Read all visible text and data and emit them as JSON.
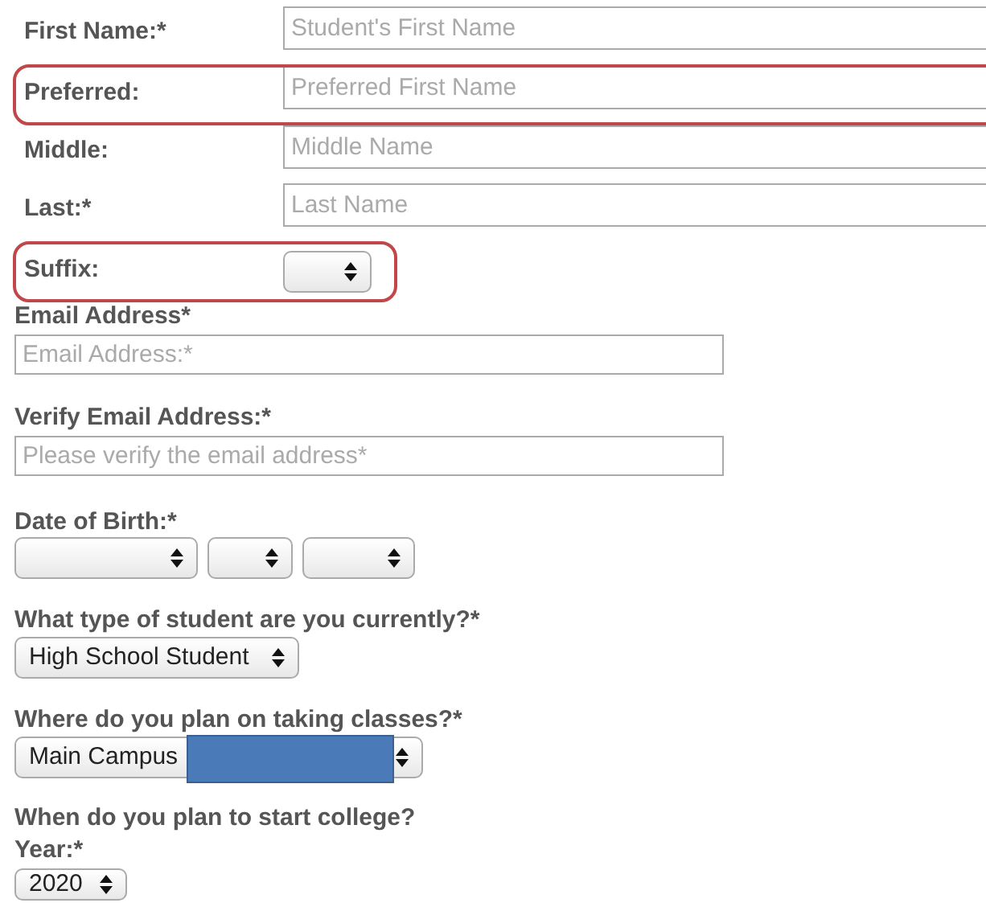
{
  "name_rows": [
    {
      "kind": "text",
      "label": "First Name:*",
      "placeholder": "Student's First Name",
      "highlighted": false
    },
    {
      "kind": "text",
      "label": "Preferred:",
      "placeholder": "Preferred First Name",
      "highlighted": true
    },
    {
      "kind": "text",
      "label": "Middle:",
      "placeholder": "Middle Name",
      "highlighted": false
    },
    {
      "kind": "text",
      "label": "Last:*",
      "placeholder": "Last Name",
      "highlighted": false
    },
    {
      "kind": "select",
      "label": "Suffix:",
      "highlighted": true
    }
  ],
  "email_fields": [
    {
      "label": "Email Address*",
      "placeholder": "Email Address:*"
    },
    {
      "label": "Verify Email Address:*",
      "placeholder": "Please verify the email address*"
    }
  ],
  "date_of_birth": {
    "label": "Date of Birth:*"
  },
  "questions": [
    {
      "label": "What type of student are you currently?*",
      "value": "High School Student",
      "redacted": false
    },
    {
      "label": "Where do you plan on taking classes?*",
      "value": "Main Campus",
      "redacted": true
    }
  ],
  "start": {
    "heading": "When do you plan to start college?",
    "year_label": "Year:*",
    "year_value": "2020"
  }
}
